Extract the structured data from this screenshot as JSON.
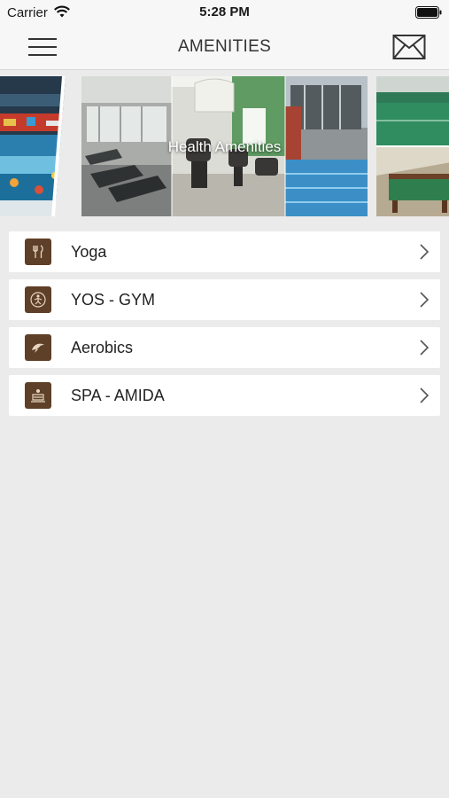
{
  "status_bar": {
    "carrier": "Carrier",
    "time": "5:28 PM"
  },
  "nav": {
    "title": "AMENITIES",
    "menu_icon": "hamburger-menu-icon",
    "mail_icon": "envelope-icon"
  },
  "banner": {
    "caption": "Health Amenities"
  },
  "list": {
    "items": [
      {
        "label": "Yoga",
        "icon": "cutlery-icon"
      },
      {
        "label": "YOS - GYM",
        "icon": "fitness-icon"
      },
      {
        "label": "Aerobics",
        "icon": "dolphin-icon"
      },
      {
        "label": "SPA - AMIDA",
        "icon": "spa-icon"
      }
    ]
  },
  "colors": {
    "icon_background": "#5e3f27",
    "page_background": "#ebebeb",
    "bar_background": "#f7f7f7"
  }
}
